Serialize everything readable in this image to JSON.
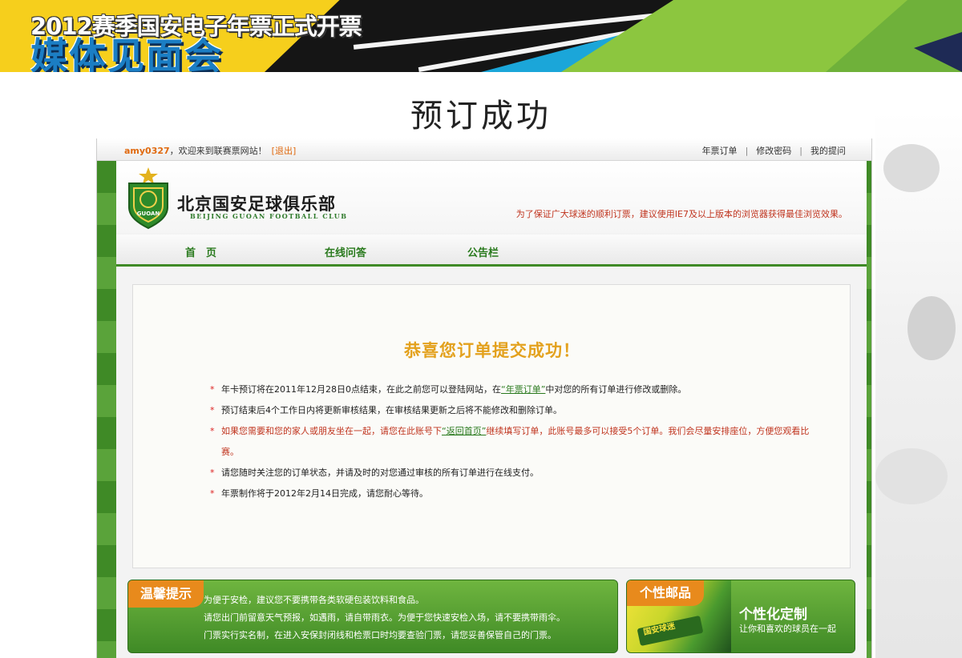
{
  "slide": {
    "banner_title": "2012赛季国安电子年票正式开票",
    "banner_subtitle": "媒体见面会",
    "heading": "预订成功"
  },
  "topbar": {
    "username": "amy0327",
    "welcome": "，欢迎来到联赛票网站！",
    "logout": "[退出]",
    "links": [
      "年票订单",
      "修改密码",
      "我的提问"
    ],
    "separator": "|"
  },
  "header": {
    "club_name_cn": "北京国安足球俱乐部",
    "club_name_en": "BEIJING GUOAN FOOTBALL CLUB",
    "browser_notice": "为了保证广大球迷的顺利订票，建议使用IE7及以上版本的浏览器获得最佳浏览效果。",
    "badge_letters": "GUOAN"
  },
  "nav": {
    "items": [
      "首　页",
      "在线问答",
      "公告栏"
    ]
  },
  "content": {
    "success_title": "恭喜您订单提交成功！",
    "star": "*",
    "rule1_a": "年卡预订将在2011年12月28日0点结束，在此之前您可以登陆网站，在",
    "rule1_link": "“年票订单”",
    "rule1_b": "中对您的所有订单进行修改或删除。",
    "rule2": "预订结束后4个工作日内将更新审核结果，在审核结果更新之后将不能修改和删除订单。",
    "rule3_a": "如果您需要和您的家人或朋友坐在一起，请您在此账号下",
    "rule3_link": "“返回首页”",
    "rule3_b": "继续填写订单，此账号最多可以接受5个订单。我们会尽量安排座位，方便您观看比赛。",
    "rule4": "请您随时关注您的订单状态，并请及时的对您通过审核的所有订单进行在线支付。",
    "rule5": "年票制作将于2012年2月14日完成，请您耐心等待。"
  },
  "tips": {
    "tag": "温馨提示",
    "lines": [
      "为便于安检，建议您不要携带各类软硬包装饮料和食品。",
      "请您出门前留意天气预报，如遇雨，请自带雨衣。为便于您快速安检入场，请不要携带雨伞。",
      "门票实行实名制，在进入安保封闭线和检票口时均要查验门票，请您妥善保管自己的门票。"
    ]
  },
  "stamp": {
    "tag": "个性邮品",
    "image_text": "国安球迷",
    "title": "个性化定制",
    "subtitle": "让你和喜欢的球员在一起"
  },
  "colors": {
    "accent_green": "#3f8a26",
    "accent_orange": "#e88a1c",
    "success_gold": "#e3a11d",
    "notice_red": "#c0341e"
  }
}
